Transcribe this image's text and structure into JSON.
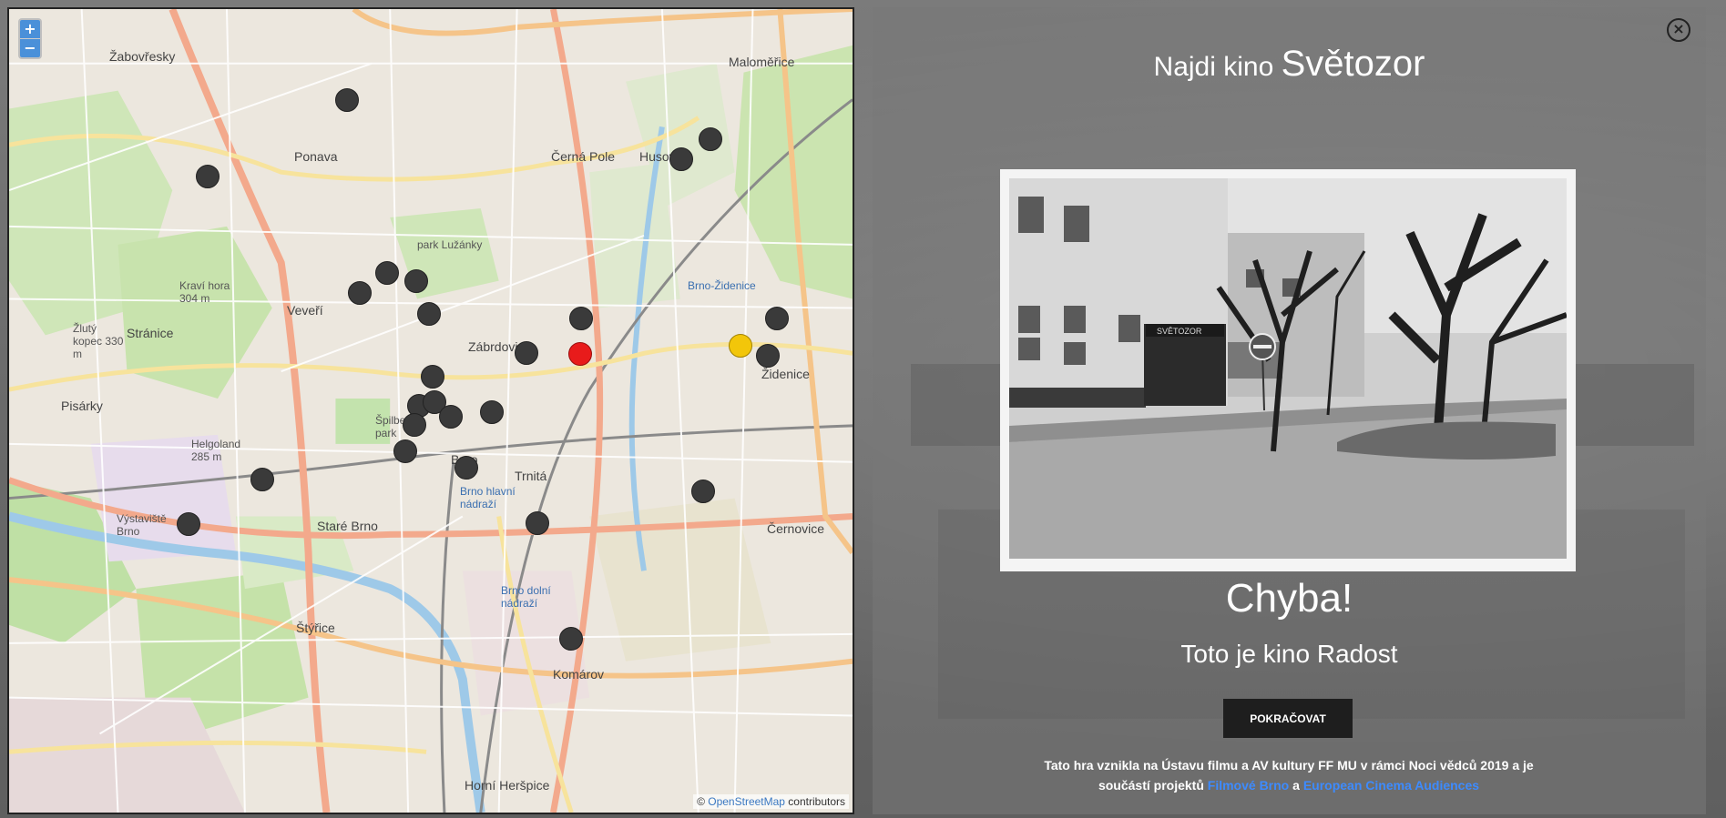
{
  "map": {
    "zoom_in": "+",
    "zoom_out": "−",
    "attribution_prefix": "©",
    "attribution_link": "OpenStreetMap",
    "attribution_suffix": " contributors",
    "labels": {
      "zabovresky": "Žabovřesky",
      "malomerice": "Maloměřice",
      "ponava": "Ponava",
      "cerna_pole": "Černá Pole",
      "husovice": "Husovice",
      "veveri": "Veveří",
      "zabrdovice": "Zábrdovice",
      "zidenice": "Židenice",
      "stranice": "Stránice",
      "pisarky": "Pisárky",
      "brno": "Brno",
      "trnita": "Trnitá",
      "stare_brno": "Staré Brno",
      "vystaviste": "Výstaviště Brno",
      "stryce": "Štýřice",
      "komarov": "Komárov",
      "cernovice": "Černovice",
      "horni_herspice": "Horní Heršpice",
      "hlavni_nadrazi": "Brno hlavní nádraží",
      "dolni_nadrazi": "Brno dolní nádraží",
      "brno_zidenice": "Brno-Židenice",
      "kravi_hora": "Kraví hora 304 m",
      "zluty_kopec": "Žlutý kopec 330 m",
      "helgoland": "Helgoland 285 m",
      "park_luzanky": "park Lužánky",
      "spilberk": "Špilberk park"
    },
    "marker_colors": {
      "default": "#3a3a3a",
      "selected": "#e81b1b",
      "correct": "#f2c60a"
    }
  },
  "panel": {
    "heading_prefix": "Najdi kino ",
    "heading_name": "Světozor",
    "result_title": "Chyba!",
    "result_text": "Toto je kino Radost",
    "continue_button": "POKRAČOVAT",
    "photo_sign": "SVĚTOZOR",
    "footer_text_1": "Tato hra vznikla na Ústavu filmu a AV kultury FF MU v rámci Noci vědců 2019 a je součástí projektů ",
    "footer_link_1": "Filmové Brno",
    "footer_and": " a ",
    "footer_link_2": "European Cinema Audiences",
    "close_icon": "close-icon"
  }
}
